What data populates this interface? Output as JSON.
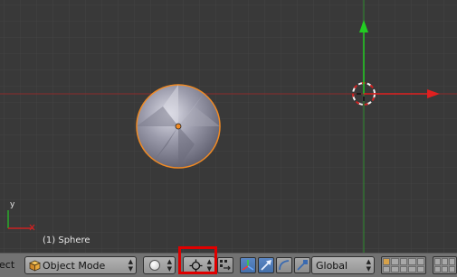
{
  "viewport": {
    "object_label": "(1) Sphere",
    "axis_label_y": "y",
    "grid_color": "#444444",
    "x_axis_color": "#8c2a2a",
    "y_axis_color": "#2e8a2e",
    "selection_color": "#f08a24"
  },
  "header": {
    "left_text": "ect",
    "mode": {
      "label": "Object Mode",
      "icon": "cube-icon"
    },
    "shading": {
      "icon": "solid-sphere-icon"
    },
    "pivot": {
      "icon": "pivot-point-icon"
    },
    "snap_icon": "align-icon",
    "manipulator_icons": [
      "manipulator-toggle-icon",
      "translate-icon",
      "rotate-icon",
      "scale-icon"
    ],
    "orientation": {
      "label": "Global"
    }
  }
}
